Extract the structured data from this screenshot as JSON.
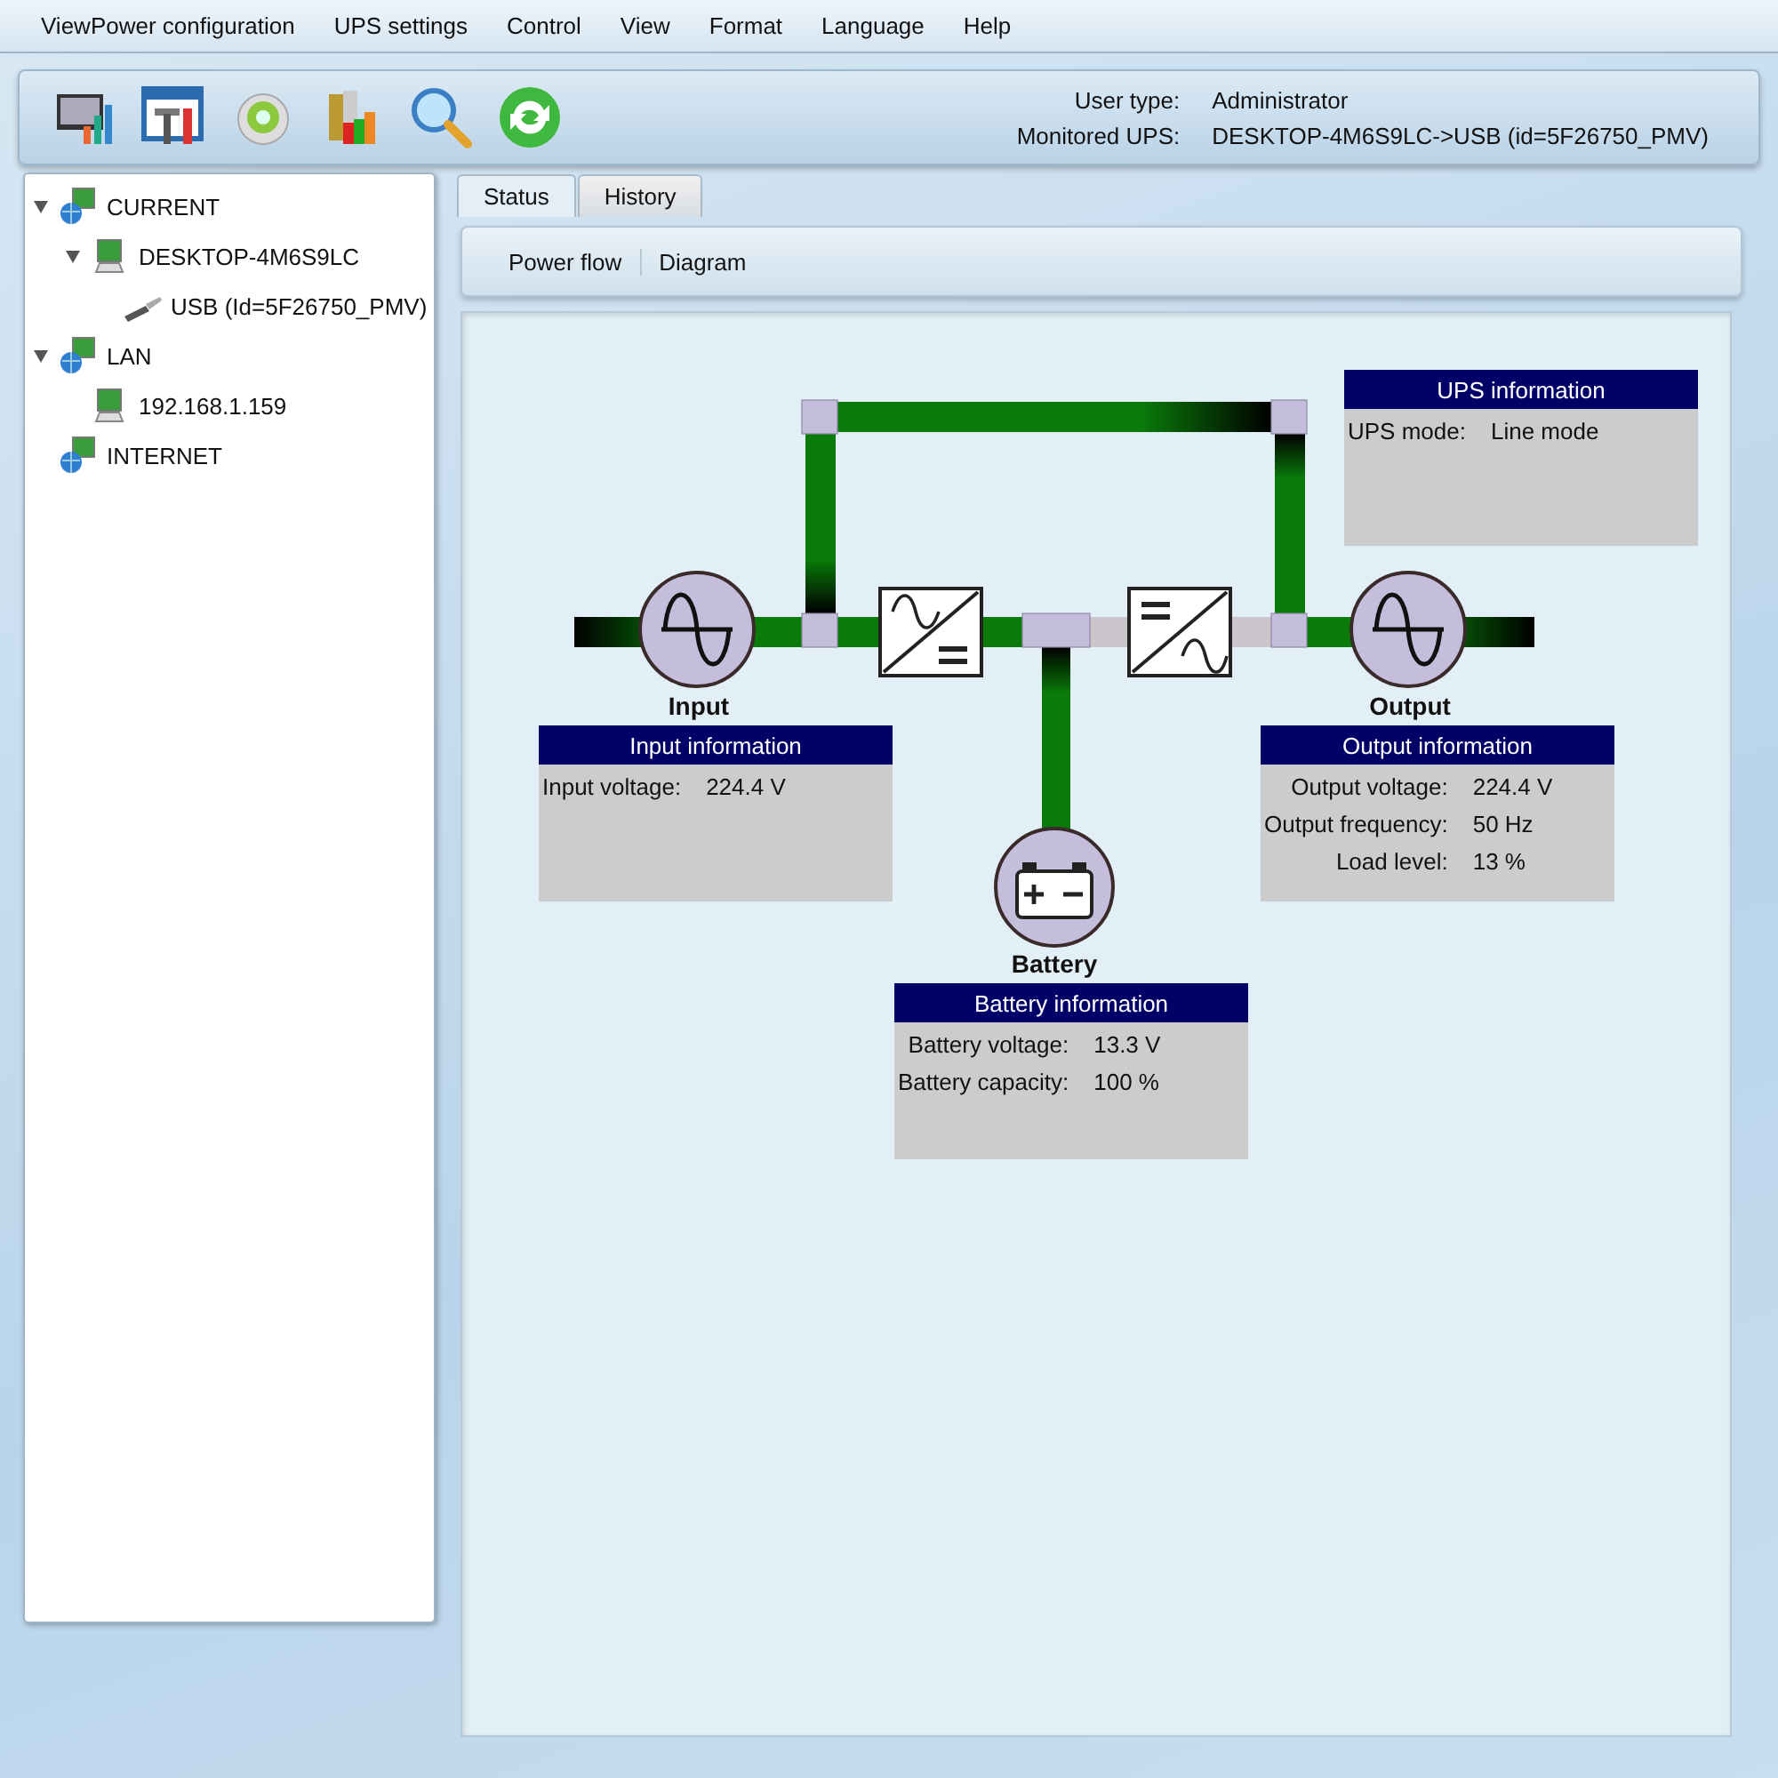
{
  "menu": [
    "ViewPower configuration",
    "UPS settings",
    "Control",
    "View",
    "Format",
    "Language",
    "Help"
  ],
  "user_info": [
    {
      "label": "User type:",
      "value": "Administrator"
    },
    {
      "label": "Monitored UPS:",
      "value": "DESKTOP-4M6S9LC->USB (id=5F26750_PMV)"
    }
  ],
  "tree": [
    {
      "label": "CURRENT",
      "kind": "network",
      "expanded": true,
      "children": [
        {
          "label": "DESKTOP-4M6S9LC",
          "kind": "computer",
          "expanded": true,
          "children": [
            {
              "label": "USB (Id=5F26750_PMV)",
              "kind": "usb"
            }
          ]
        }
      ]
    },
    {
      "label": "LAN",
      "kind": "network",
      "expanded": true,
      "children": [
        {
          "label": "192.168.1.159",
          "kind": "computer"
        }
      ]
    },
    {
      "label": "INTERNET",
      "kind": "network"
    }
  ],
  "tabs": [
    {
      "label": "Status",
      "selected": true
    },
    {
      "label": "History",
      "selected": false
    }
  ],
  "subnav": [
    "Power flow",
    "Diagram"
  ],
  "diagram": {
    "nodes": [
      {
        "kind": "input",
        "label": "Input"
      },
      {
        "kind": "output",
        "label": "Output"
      },
      {
        "kind": "battery",
        "label": "Battery"
      }
    ],
    "panels": [
      {
        "kind": "ups",
        "title": "UPS information",
        "rows": [
          {
            "label": "UPS mode:",
            "value": "Line mode"
          }
        ]
      },
      {
        "kind": "input",
        "title": "Input information",
        "rows": [
          {
            "label": "Input voltage:",
            "value": "224.4 V"
          }
        ]
      },
      {
        "kind": "output",
        "title": "Output information",
        "rows": [
          {
            "label": "Output voltage:",
            "value": "224.4 V"
          },
          {
            "label": "Output frequency:",
            "value": "50 Hz"
          },
          {
            "label": "Load level:",
            "value": "13 %"
          }
        ]
      },
      {
        "kind": "battery",
        "title": "Battery information",
        "rows": [
          {
            "label": "Battery voltage:",
            "value": "13.3 V"
          },
          {
            "label": "Battery capacity:",
            "value": "100 %"
          }
        ]
      }
    ]
  }
}
